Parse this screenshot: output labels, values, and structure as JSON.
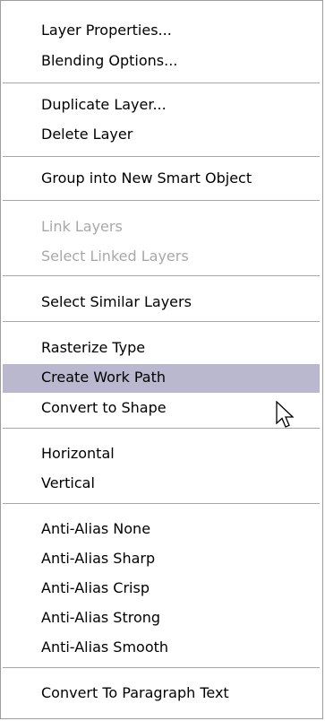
{
  "menu": {
    "items": [
      {
        "label": "Layer Properties...",
        "enabled": true
      },
      {
        "label": "Blending Options...",
        "enabled": true
      },
      {
        "label": "Duplicate Layer...",
        "enabled": true
      },
      {
        "label": "Delete Layer",
        "enabled": true
      },
      {
        "label": "Group into New Smart Object",
        "enabled": true
      },
      {
        "label": "Link Layers",
        "enabled": false
      },
      {
        "label": "Select Linked Layers",
        "enabled": false
      },
      {
        "label": "Select Similar Layers",
        "enabled": true
      },
      {
        "label": "Rasterize Type",
        "enabled": true
      },
      {
        "label": "Create Work Path",
        "enabled": true,
        "highlighted": true
      },
      {
        "label": "Convert to Shape",
        "enabled": true
      },
      {
        "label": "Horizontal",
        "enabled": true
      },
      {
        "label": "Vertical",
        "enabled": true
      },
      {
        "label": "Anti-Alias None",
        "enabled": true
      },
      {
        "label": "Anti-Alias Sharp",
        "enabled": true
      },
      {
        "label": "Anti-Alias Crisp",
        "enabled": true
      },
      {
        "label": "Anti-Alias Strong",
        "enabled": true
      },
      {
        "label": "Anti-Alias Smooth",
        "enabled": true
      },
      {
        "label": "Convert To Paragraph Text",
        "enabled": true
      }
    ],
    "highlight_color": "#b9b8cf",
    "disabled_color": "#a8a8a8"
  },
  "cursor": {
    "icon": "arrow-pointer-icon"
  }
}
